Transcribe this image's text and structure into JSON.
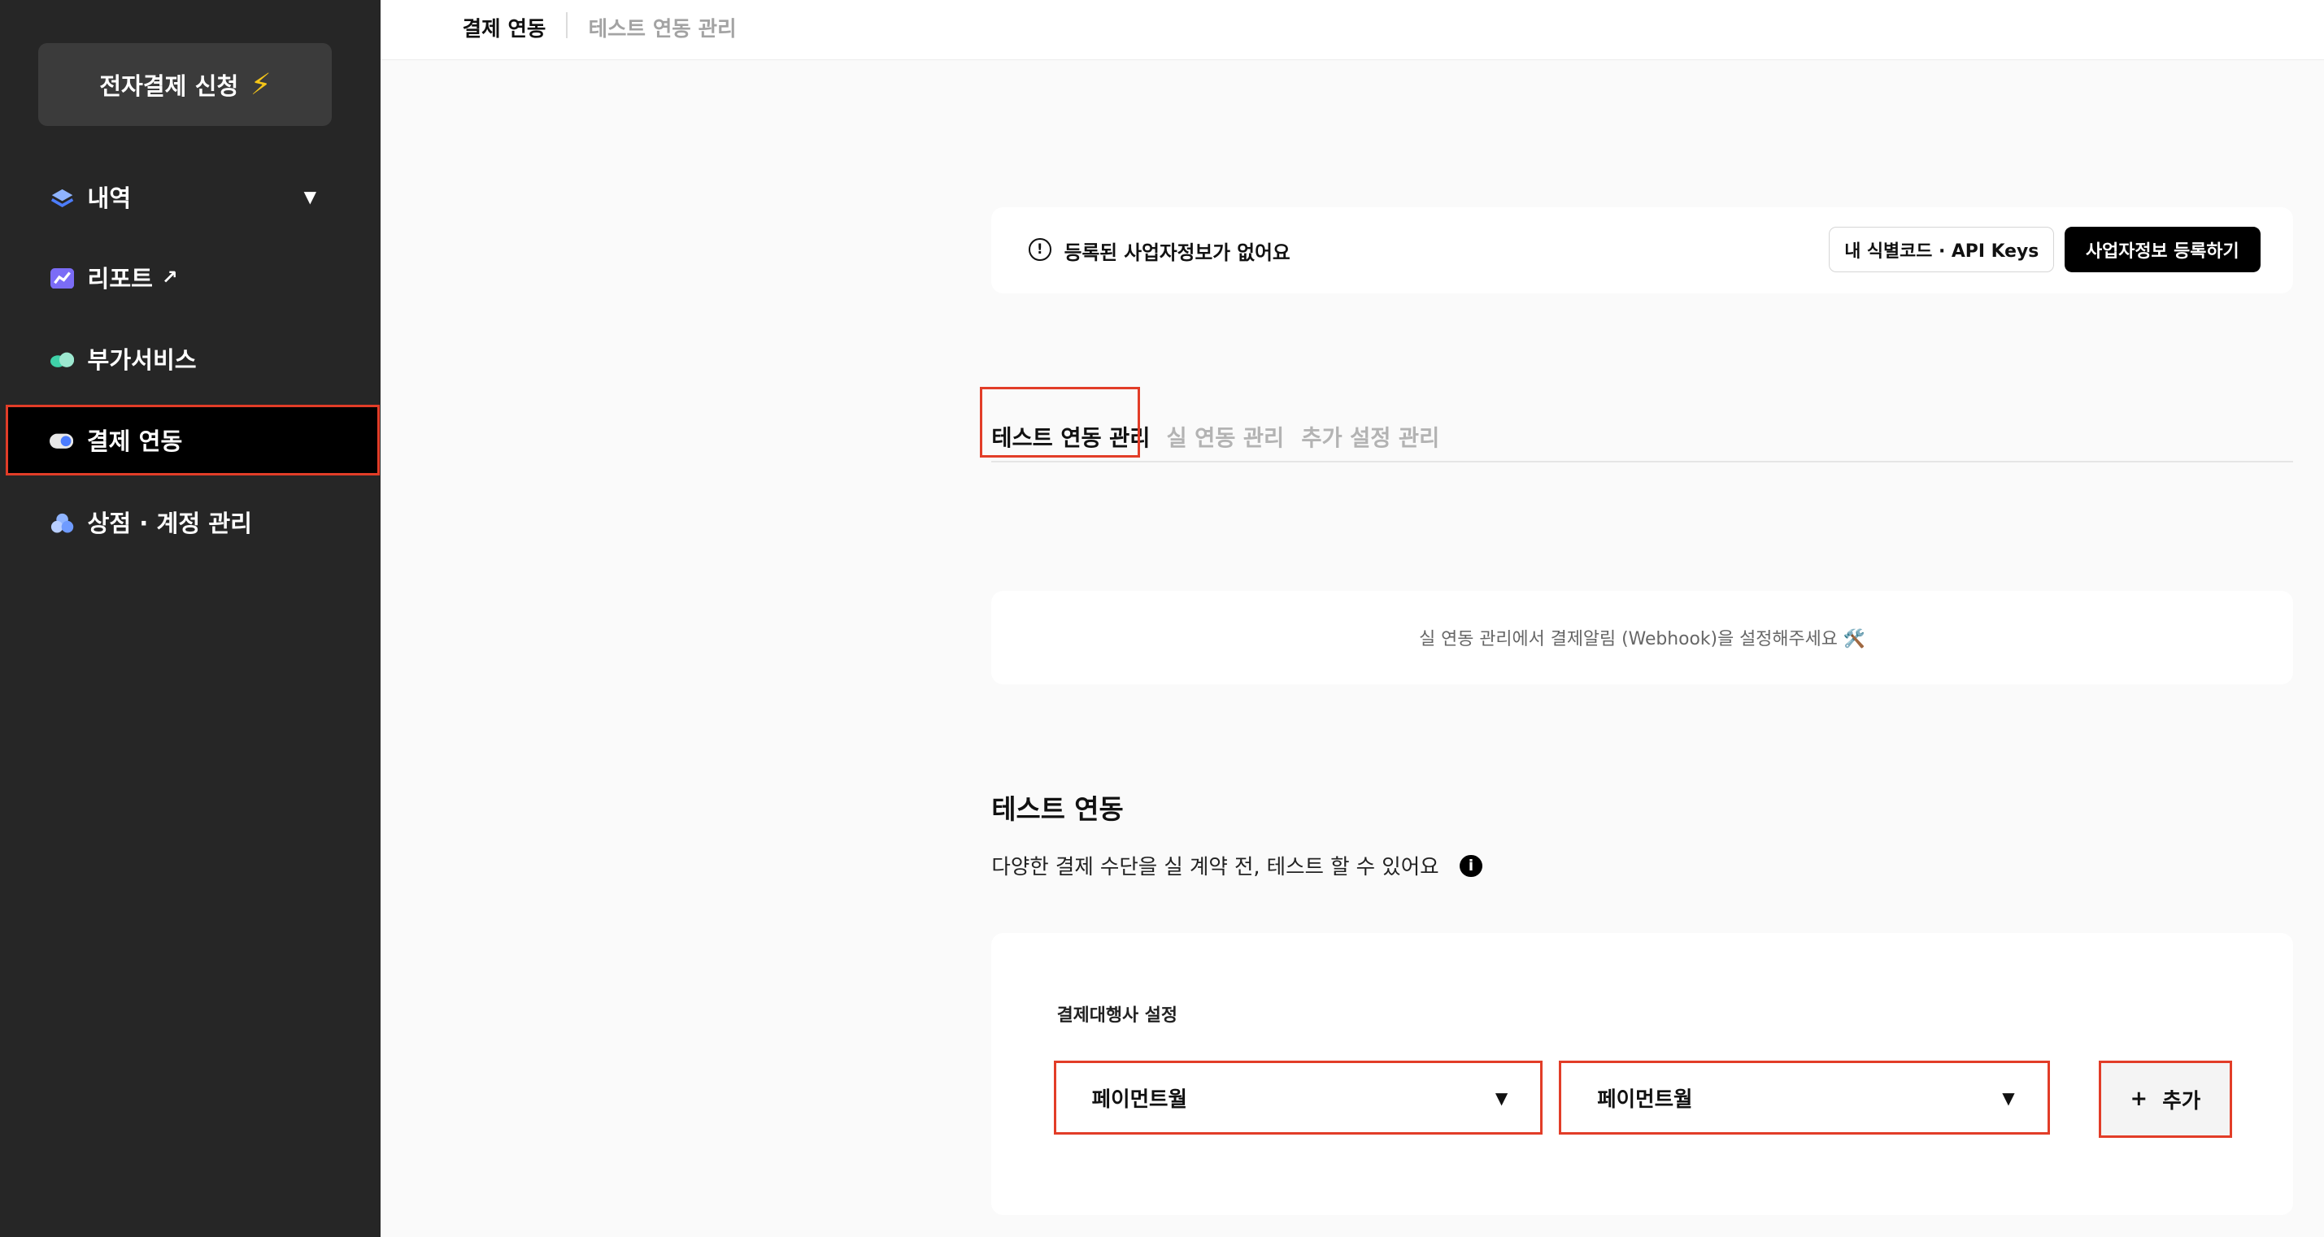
{
  "sidebar": {
    "apply_button": "전자결제 신청",
    "items": [
      {
        "label": "내역",
        "icon": "layers-icon",
        "has_caret": true
      },
      {
        "label": "리포트",
        "icon": "chart-icon",
        "external": true
      },
      {
        "label": "부가서비스",
        "icon": "cloud-icon"
      },
      {
        "label": "결제 연동",
        "icon": "toggle-icon",
        "active": true
      },
      {
        "label": "상점 · 계정 관리",
        "icon": "store-icon"
      }
    ]
  },
  "header": {
    "breadcrumb_current": "결제 연동",
    "breadcrumb_sub": "테스트 연동 관리"
  },
  "notice": {
    "text": "등록된 사업자정보가 없어요",
    "keys_button": "내 식별코드 · API Keys",
    "register_button": "사업자정보 등록하기"
  },
  "tabs": [
    {
      "label": "테스트 연동 관리",
      "active": true
    },
    {
      "label": "실 연동 관리"
    },
    {
      "label": "추가 설정 관리"
    }
  ],
  "webhook_notice": "실 연동 관리에서 결제알림 (Webhook)을 설정해주세요 🛠️",
  "test_section": {
    "title": "테스트 연동",
    "description": "다양한 결제 수단을 실 계약 전, 테스트 할 수 있어요",
    "pg_label": "결제대행사 설정",
    "select1_value": "페이먼트월",
    "select2_value": "페이먼트월",
    "add_button": "추가"
  },
  "colors": {
    "sidebar_bg": "#262626",
    "highlight": "#e23d28",
    "bolt": "#f5c518"
  }
}
